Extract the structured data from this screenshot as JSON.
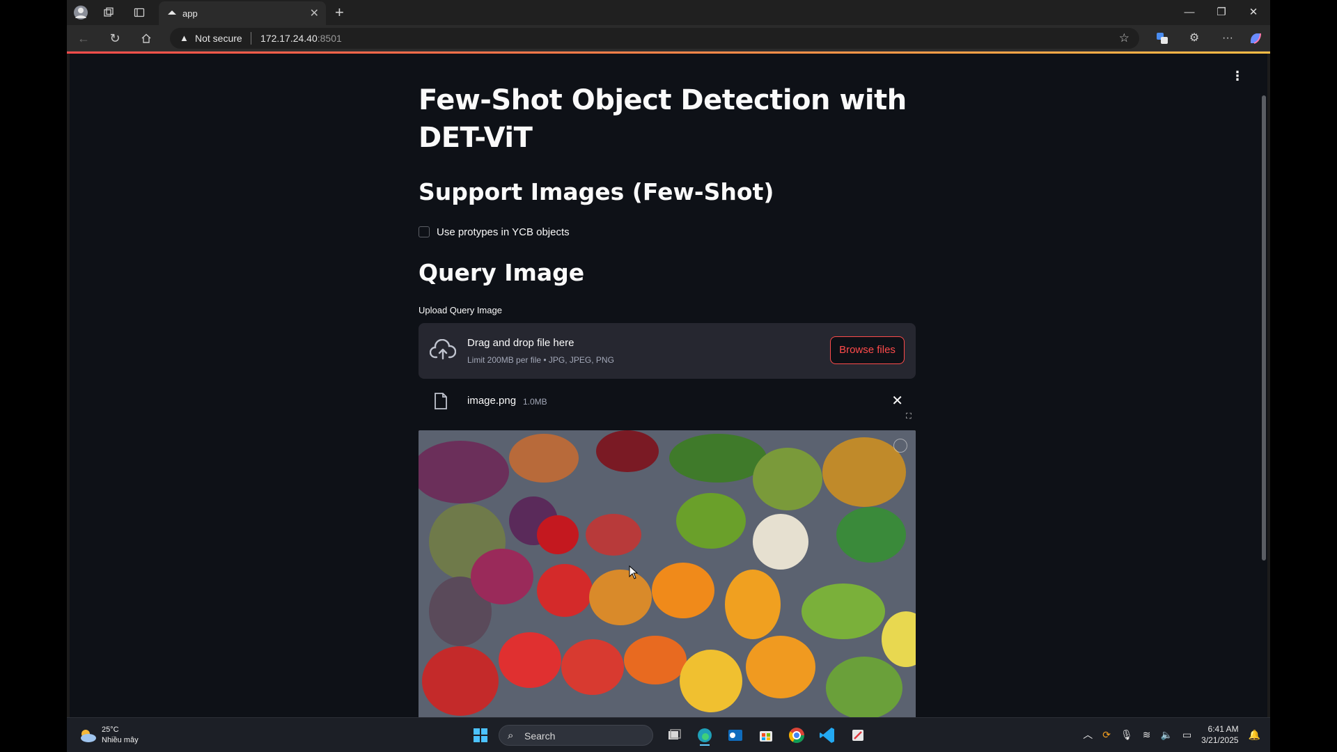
{
  "browser": {
    "tab_title": "app",
    "security_label": "Not secure",
    "url_host": "172.17.24.40",
    "url_port": ":8501",
    "colors": {
      "accent_gradient_start": "#ff4b4b",
      "accent_gradient_end": "#ffbd45"
    }
  },
  "app": {
    "title": "Few-Shot Object Detection with DET-ViT",
    "support_heading": "Support Images (Few-Shot)",
    "checkbox_label": "Use protypes in YCB objects",
    "checkbox_checked": false,
    "query_heading": "Query Image",
    "uploader_label": "Upload Query Image",
    "dropzone_title": "Drag and drop file here",
    "dropzone_subtitle": "Limit 200MB per file • JPG, JPEG, PNG",
    "browse_button": "Browse files",
    "uploaded_file": {
      "name": "image.png",
      "size": "1.0MB"
    },
    "colors": {
      "background": "#0e1117",
      "surface": "#262730",
      "primary": "#ff4b4b",
      "text": "#fafafa"
    }
  },
  "taskbar": {
    "weather_temp": "25°C",
    "weather_desc": "Nhiều mây",
    "search_placeholder": "Search",
    "time": "6:41 AM",
    "date": "3/21/2025"
  }
}
